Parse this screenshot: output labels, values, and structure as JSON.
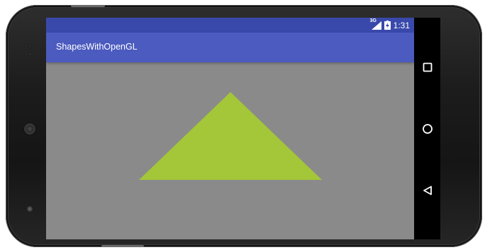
{
  "status_bar": {
    "network_type": "3G",
    "time": "1:31",
    "color": "#3949ab"
  },
  "app_bar": {
    "title": "ShapesWithOpenGL",
    "color": "#4c5bbf"
  },
  "canvas": {
    "background_color": "#8a8a8a",
    "shape": "triangle",
    "shape_color": "#a4c639"
  },
  "navigation": {
    "recents": "recents-square-icon",
    "home": "home-circle-icon",
    "back": "back-triangle-icon"
  }
}
